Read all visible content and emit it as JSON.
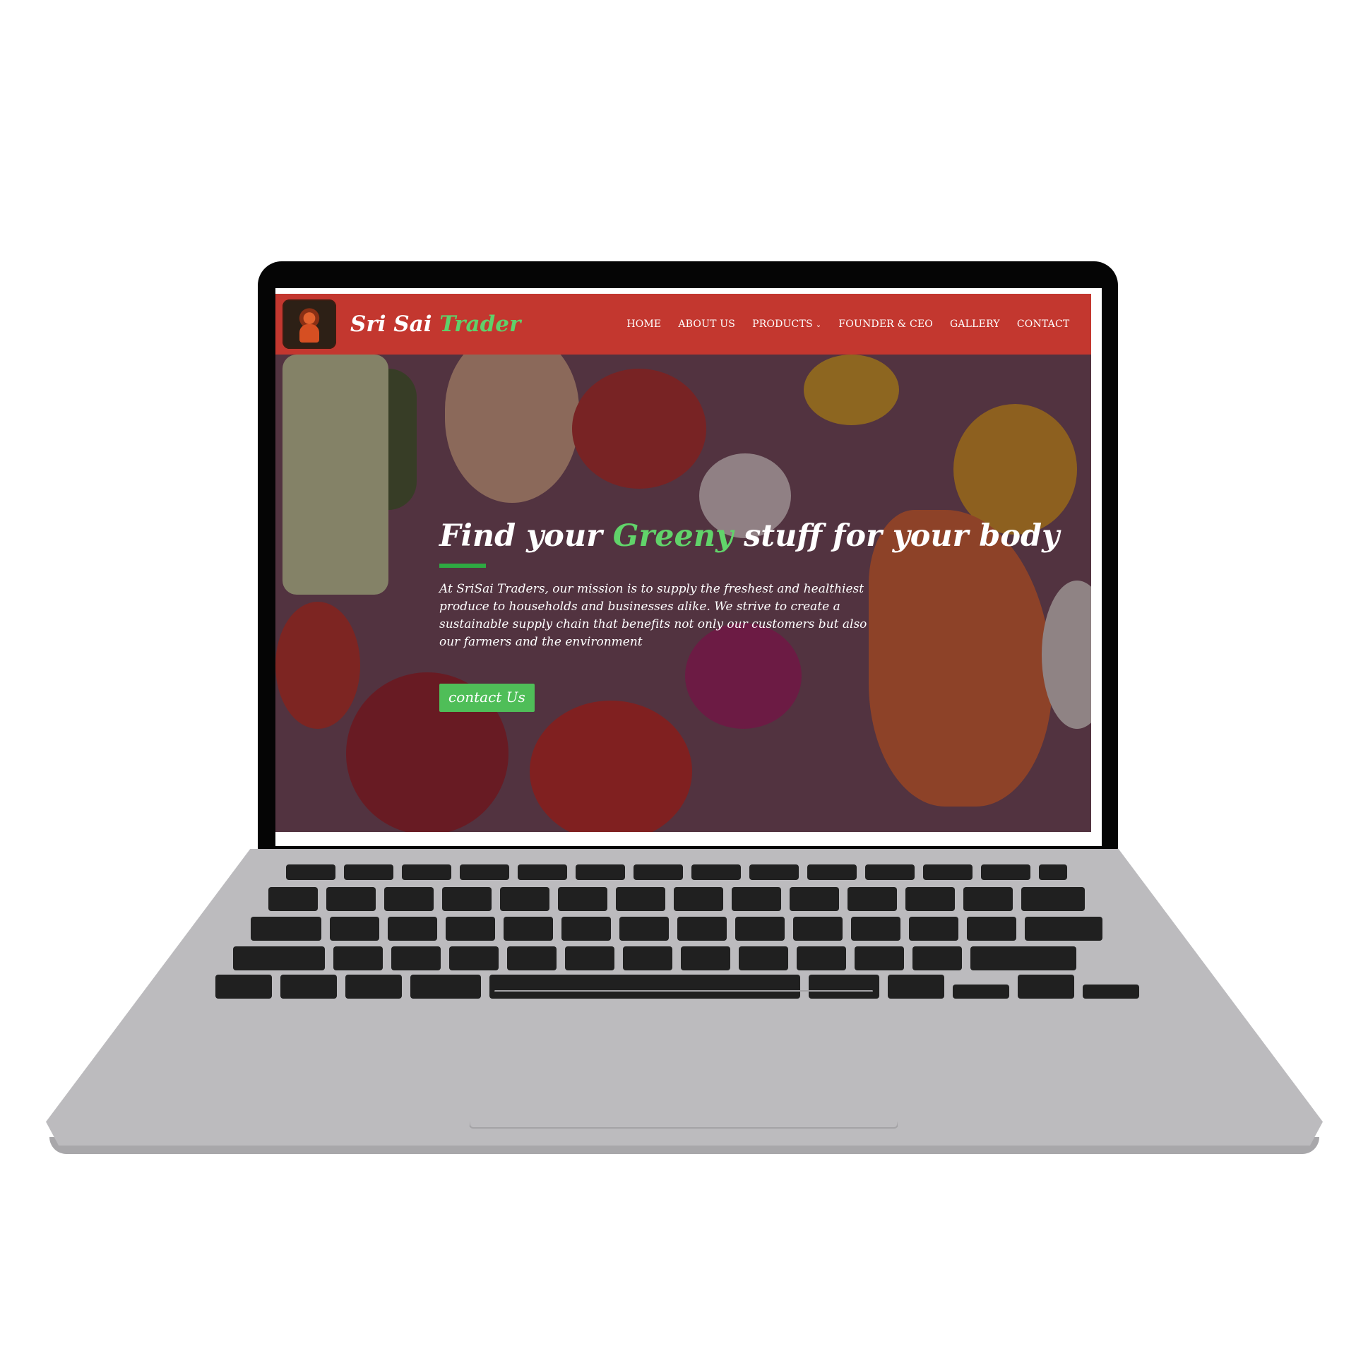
{
  "site": {
    "brand_part1": "Sri Sai",
    "brand_part2": "Trader",
    "nav": {
      "home": "HOME",
      "about": "ABOUT US",
      "products": "PRODUCTS",
      "founder": "FOUNDER & CEO",
      "gallery": "GALLERY",
      "contact": "CONTACT"
    }
  },
  "hero": {
    "title_pre": "Find your",
    "title_accent": "Greeny",
    "title_post": "stuff for your body",
    "description": "At SriSai Traders, our mission is to supply the freshest and healthiest produce to households and businesses alike. We strive to create a sustainable supply chain that benefits not only our customers but also our farmers and the environment",
    "cta_label": "contact Us"
  },
  "colors": {
    "nav_bg": "#c3372f",
    "accent_green": "#5fd06a",
    "button_green": "#4fbe58",
    "laptop_body": "#bcbbbe"
  },
  "icons": {
    "dropdown": "chevron-down-icon",
    "logo": "saint-portrait-logo"
  }
}
